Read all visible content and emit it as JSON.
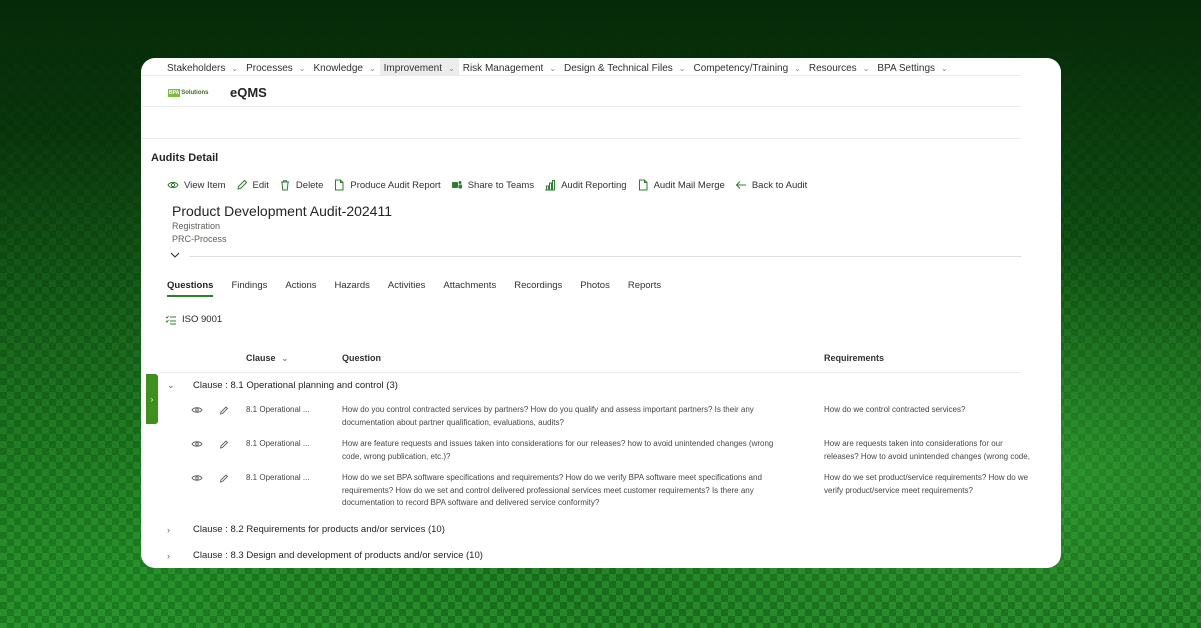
{
  "nav": {
    "items": [
      {
        "label": "Stakeholders"
      },
      {
        "label": "Processes"
      },
      {
        "label": "Knowledge"
      },
      {
        "label": "Improvement"
      },
      {
        "label": "Risk Management"
      },
      {
        "label": "Design & Technical Files"
      },
      {
        "label": "Competency/Training"
      },
      {
        "label": "Resources"
      },
      {
        "label": "BPA Settings"
      }
    ],
    "active_item": "Improvement"
  },
  "brand": {
    "logo_box": "BPA",
    "logo_text": "Solutions",
    "app_title": "eQMS"
  },
  "section_title": "Audits Detail",
  "commands": [
    {
      "label": "View Item",
      "icon": "eye-icon"
    },
    {
      "label": "Edit",
      "icon": "pencil-icon"
    },
    {
      "label": "Delete",
      "icon": "trash-icon"
    },
    {
      "label": "Produce Audit Report",
      "icon": "document-icon"
    },
    {
      "label": "Share to Teams",
      "icon": "teams-icon"
    },
    {
      "label": "Audit Reporting",
      "icon": "chart-icon"
    },
    {
      "label": "Audit Mail Merge",
      "icon": "document-icon"
    },
    {
      "label": "Back to Audit",
      "icon": "arrow-left-icon"
    }
  ],
  "item": {
    "title": "Product Development Audit-202411",
    "type": "Registration",
    "process": "PRC-Process"
  },
  "tabs": [
    {
      "label": "Questions"
    },
    {
      "label": "Findings"
    },
    {
      "label": "Actions"
    },
    {
      "label": "Hazards"
    },
    {
      "label": "Activities"
    },
    {
      "label": "Attachments"
    },
    {
      "label": "Recordings"
    },
    {
      "label": "Photos"
    },
    {
      "label": "Reports"
    }
  ],
  "active_tab": "Questions",
  "standard": "ISO 9001",
  "table": {
    "headers": {
      "clause": "Clause",
      "question": "Question",
      "requirements": "Requirements"
    },
    "groups": [
      {
        "label": "Clause : 8.1 Operational planning and control (3)",
        "expanded": true
      },
      {
        "label": "Clause : 8.2 Requirements for products and/or services (10)",
        "expanded": false
      },
      {
        "label": "Clause : 8.3 Design and development of products and/or service (10)",
        "expanded": false
      }
    ],
    "rows": [
      {
        "clause": "8.1 Operational ...",
        "question": "How do you control contracted services by partners? How do you qualify and assess important partners? Is their any documentation about partner qualification, evaluations, audits?",
        "requirements": "How do we control contracted services?"
      },
      {
        "clause": "8.1 Operational ...",
        "question": "How are feature requests and issues taken into considerations for our releases? how to avoid unintended changes (wrong code, wrong publication, etc.)?",
        "requirements": "How are requests taken into considerations for our releases? How to avoid unintended changes (wrong code, wrong publication, etc.)?"
      },
      {
        "clause": "8.1 Operational ...",
        "question": "How do we set BPA software specifications and requirements? How do we verify BPA software meet specifications and requirements? How do we set and control delivered professional services meet customer requirements? Is there any documentation to record BPA software and delivered service conformity?",
        "requirements": "How do we set product/service requirements? How do we verify product/service meet requirements?"
      }
    ]
  }
}
